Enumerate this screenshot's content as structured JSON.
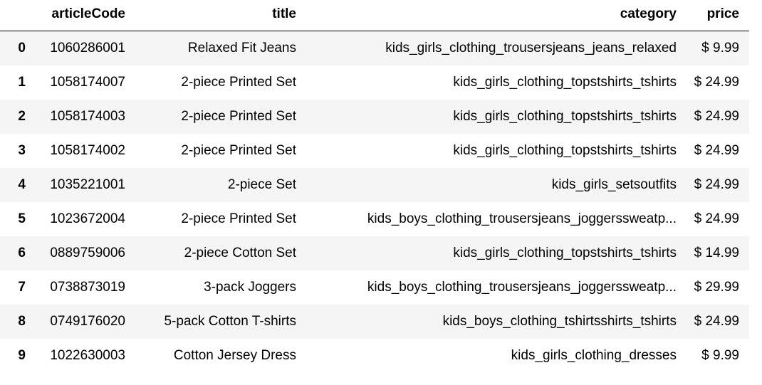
{
  "columns": [
    "",
    "articleCode",
    "title",
    "category",
    "price"
  ],
  "rows": [
    {
      "index": "0",
      "articleCode": "1060286001",
      "title": "Relaxed Fit Jeans",
      "category": "kids_girls_clothing_trousersjeans_jeans_relaxed",
      "price": "$ 9.99"
    },
    {
      "index": "1",
      "articleCode": "1058174007",
      "title": "2-piece Printed Set",
      "category": "kids_girls_clothing_topstshirts_tshirts",
      "price": "$ 24.99"
    },
    {
      "index": "2",
      "articleCode": "1058174003",
      "title": "2-piece Printed Set",
      "category": "kids_girls_clothing_topstshirts_tshirts",
      "price": "$ 24.99"
    },
    {
      "index": "3",
      "articleCode": "1058174002",
      "title": "2-piece Printed Set",
      "category": "kids_girls_clothing_topstshirts_tshirts",
      "price": "$ 24.99"
    },
    {
      "index": "4",
      "articleCode": "1035221001",
      "title": "2-piece Set",
      "category": "kids_girls_setsoutfits",
      "price": "$ 24.99"
    },
    {
      "index": "5",
      "articleCode": "1023672004",
      "title": "2-piece Printed Set",
      "category": "kids_boys_clothing_trousersjeans_joggerssweatp...",
      "price": "$ 24.99"
    },
    {
      "index": "6",
      "articleCode": "0889759006",
      "title": "2-piece Cotton Set",
      "category": "kids_girls_clothing_topstshirts_tshirts",
      "price": "$ 14.99"
    },
    {
      "index": "7",
      "articleCode": "0738873019",
      "title": "3-pack Joggers",
      "category": "kids_boys_clothing_trousersjeans_joggerssweatp...",
      "price": "$ 29.99"
    },
    {
      "index": "8",
      "articleCode": "0749176020",
      "title": "5-pack Cotton T-shirts",
      "category": "kids_boys_clothing_tshirtsshirts_tshirts",
      "price": "$ 24.99"
    },
    {
      "index": "9",
      "articleCode": "1022630003",
      "title": "Cotton Jersey Dress",
      "category": "kids_girls_clothing_dresses",
      "price": "$ 9.99"
    }
  ]
}
